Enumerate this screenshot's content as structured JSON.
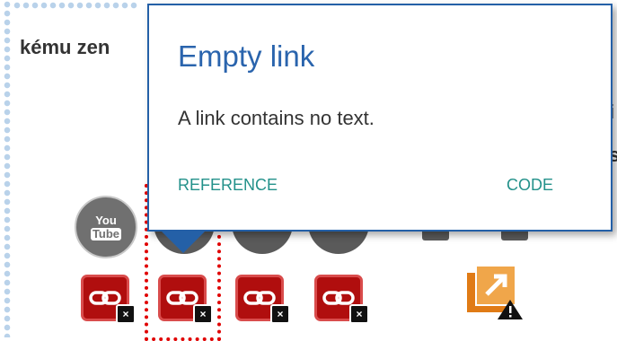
{
  "background": {
    "heading": "kému zen",
    "right_fragments": [
      "i",
      "s"
    ]
  },
  "tooltip": {
    "title": "Empty link",
    "description": "A link contains no text.",
    "reference_label": "REFERENCE",
    "code_label": "CODE"
  },
  "youtube_icon": {
    "line1": "You",
    "line2": "Tube"
  },
  "error_badge_text": "×",
  "colors": {
    "tooltip_border": "#2460a7",
    "title": "#2a64ad",
    "link_actions": "#23918a",
    "error_icon": "#b00e0e",
    "selection_outline": "#e00000",
    "warning_orange": "#e07b16"
  },
  "icons": [
    "youtube-icon",
    "link-error-icon",
    "close-badge-icon",
    "external-link-warning-icon"
  ]
}
